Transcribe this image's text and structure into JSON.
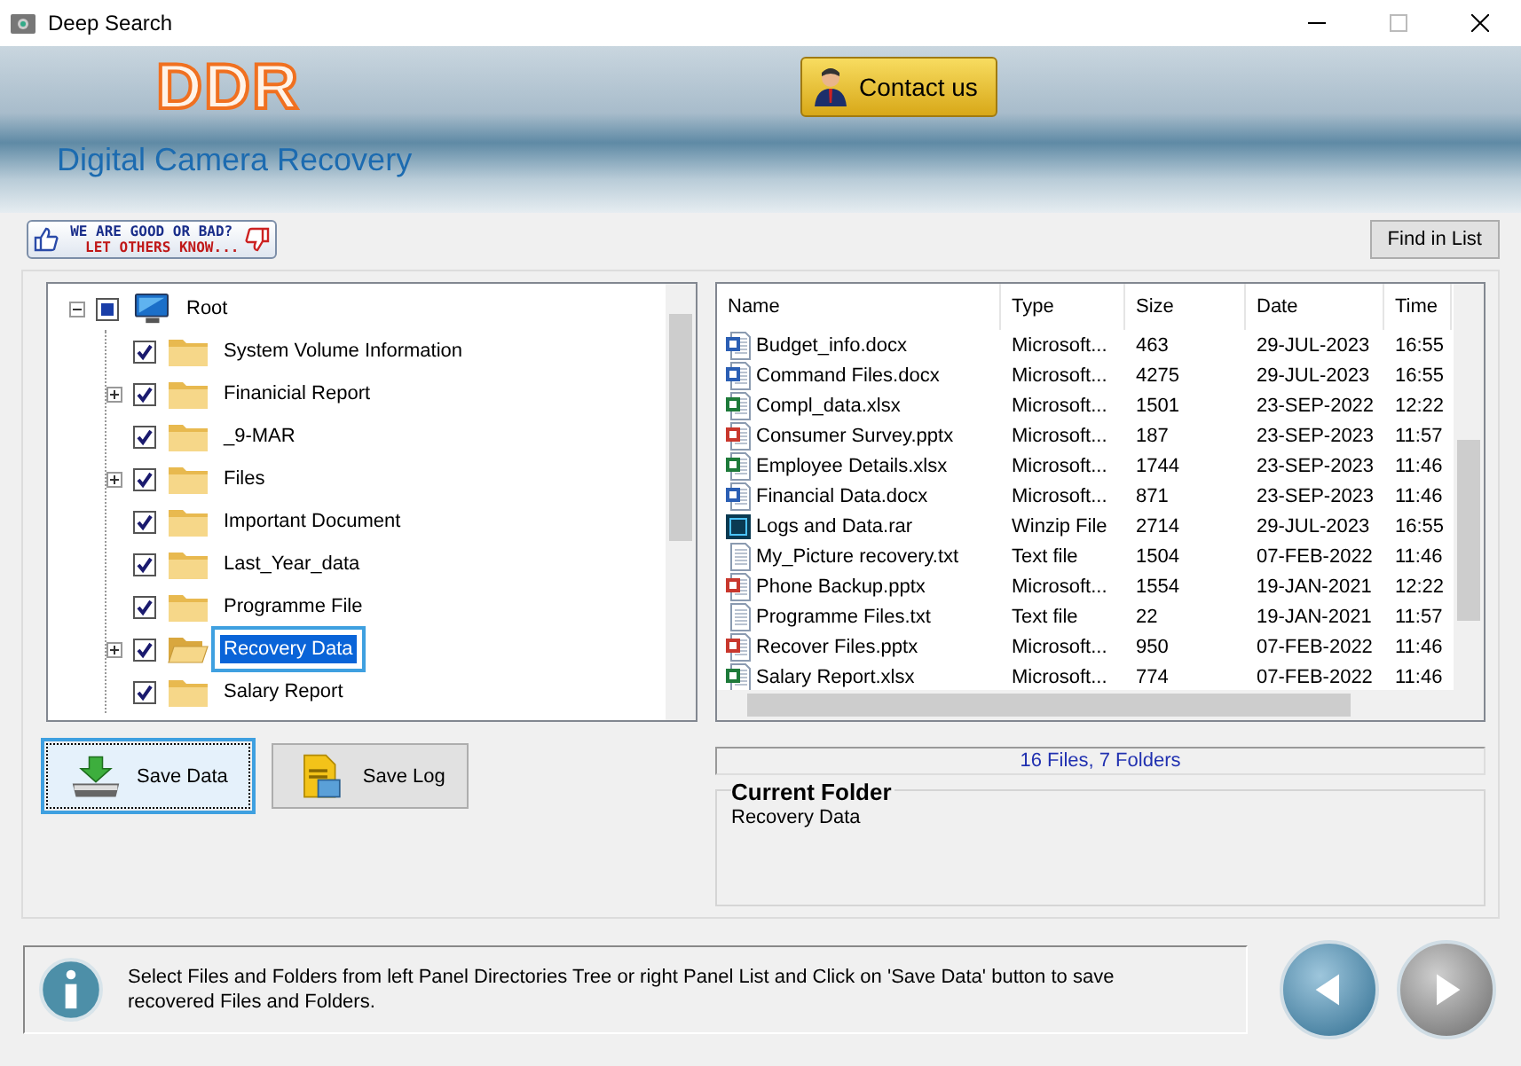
{
  "window": {
    "title": "Deep Search"
  },
  "header": {
    "logo": "DDR",
    "contact_button": "Contact us",
    "product_name": "Digital Camera Recovery"
  },
  "feedback_banner": {
    "line_1": "WE ARE GOOD OR BAD?",
    "line_2": "LET OTHERS KNOW..."
  },
  "find_button": "Find in List",
  "tree": {
    "label": "Root",
    "kind": "computer",
    "checked": true,
    "partial": true,
    "expandable": true,
    "expanded": true,
    "selected": false,
    "children": [
      {
        "label": "System Volume Information",
        "kind": "folder",
        "checked": true,
        "partial": false,
        "expandable": false,
        "selected": false
      },
      {
        "label": "Finanicial Report",
        "kind": "folder",
        "checked": true,
        "partial": false,
        "expandable": true,
        "expanded": false,
        "selected": false
      },
      {
        "label": "_9-MAR",
        "kind": "folder",
        "checked": true,
        "partial": false,
        "expandable": false,
        "selected": false
      },
      {
        "label": "Files",
        "kind": "folder",
        "checked": true,
        "partial": false,
        "expandable": true,
        "expanded": false,
        "selected": false
      },
      {
        "label": "Important Document",
        "kind": "folder",
        "checked": true,
        "partial": false,
        "expandable": false,
        "selected": false
      },
      {
        "label": "Last_Year_data",
        "kind": "folder",
        "checked": true,
        "partial": false,
        "expandable": false,
        "selected": false
      },
      {
        "label": "Programme File",
        "kind": "folder",
        "checked": true,
        "partial": false,
        "expandable": false,
        "selected": false
      },
      {
        "label": "Recovery Data",
        "kind": "folder",
        "checked": true,
        "partial": false,
        "expandable": true,
        "expanded": false,
        "selected": true
      },
      {
        "label": "Salary Report",
        "kind": "folder",
        "checked": true,
        "partial": false,
        "expandable": false,
        "selected": false
      }
    ]
  },
  "file_list": {
    "columns": [
      "Name",
      "Type",
      "Size",
      "Date",
      "Time"
    ],
    "rows": [
      {
        "kind": "word",
        "cells": [
          "Budget_info.docx",
          "Microsoft...",
          "463",
          "29-JUL-2023",
          "16:55"
        ]
      },
      {
        "kind": "word",
        "cells": [
          "Command Files.docx",
          "Microsoft...",
          "4275",
          "29-JUL-2023",
          "16:55"
        ]
      },
      {
        "kind": "excel",
        "cells": [
          "Compl_data.xlsx",
          "Microsoft...",
          "1501",
          "23-SEP-2022",
          "12:22"
        ]
      },
      {
        "kind": "powerpoint",
        "cells": [
          "Consumer Survey.pptx",
          "Microsoft...",
          "187",
          "23-SEP-2023",
          "11:57"
        ]
      },
      {
        "kind": "excel",
        "cells": [
          "Employee Details.xlsx",
          "Microsoft...",
          "1744",
          "23-SEP-2023",
          "11:46"
        ]
      },
      {
        "kind": "word",
        "cells": [
          "Financial Data.docx",
          "Microsoft...",
          "871",
          "23-SEP-2023",
          "11:46"
        ]
      },
      {
        "kind": "photoshop",
        "cells": [
          "Logs and Data.rar",
          "Winzip File",
          "2714",
          "29-JUL-2023",
          "16:55"
        ]
      },
      {
        "kind": "text",
        "cells": [
          "My_Picture recovery.txt",
          "Text file",
          "1504",
          "07-FEB-2022",
          "11:46"
        ]
      },
      {
        "kind": "powerpoint",
        "cells": [
          "Phone Backup.pptx",
          "Microsoft...",
          "1554",
          "19-JAN-2021",
          "12:22"
        ]
      },
      {
        "kind": "text",
        "cells": [
          "Programme Files.txt",
          "Text file",
          "22",
          "19-JAN-2021",
          "11:57"
        ]
      },
      {
        "kind": "powerpoint",
        "cells": [
          "Recover Files.pptx",
          "Microsoft...",
          "950",
          "07-FEB-2022",
          "11:46"
        ]
      },
      {
        "kind": "excel",
        "cells": [
          "Salary Report.xlsx",
          "Microsoft...",
          "774",
          "07-FEB-2022",
          "11:46"
        ]
      }
    ]
  },
  "buttons": [
    {
      "kind": "save",
      "label": "Save Data",
      "focused": true
    },
    {
      "kind": "log",
      "label": "Save Log",
      "focused": false
    }
  ],
  "status": "16 Files, 7 Folders",
  "current_folder": {
    "title": "Current Folder",
    "value": "Recovery Data"
  },
  "info_message": "Select Files and Folders from left Panel Directories Tree or right Panel List and Click on 'Save Data' button to save recovered Files and Folders.",
  "nav_buttons": [
    {
      "kind": "back",
      "disabled": false
    },
    {
      "kind": "next",
      "disabled": true
    }
  ]
}
